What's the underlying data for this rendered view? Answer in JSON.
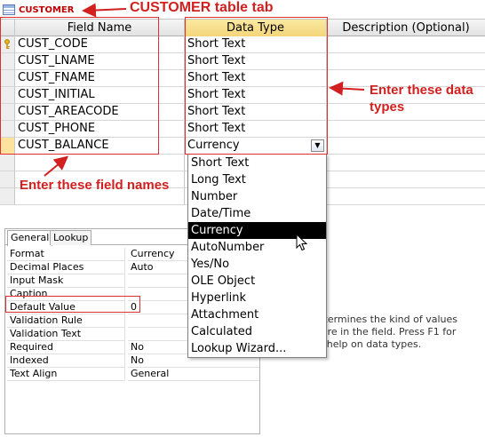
{
  "tab": {
    "label": "CUSTOMER"
  },
  "grid": {
    "headers": {
      "field_name": "Field Name",
      "data_type": "Data Type",
      "description": "Description (Optional)"
    },
    "rows": [
      {
        "field": "CUST_CODE",
        "type": "Short Text"
      },
      {
        "field": "CUST_LNAME",
        "type": "Short Text"
      },
      {
        "field": "CUST_FNAME",
        "type": "Short Text"
      },
      {
        "field": "CUST_INITIAL",
        "type": "Short Text"
      },
      {
        "field": "CUST_AREACODE",
        "type": "Short Text"
      },
      {
        "field": "CUST_PHONE",
        "type": "Short Text"
      },
      {
        "field": "CUST_BALANCE",
        "type": "Currency"
      }
    ]
  },
  "dropdown": {
    "options": [
      "Short Text",
      "Long Text",
      "Number",
      "Date/Time",
      "Currency",
      "AutoNumber",
      "Yes/No",
      "OLE Object",
      "Hyperlink",
      "Attachment",
      "Calculated",
      "Lookup Wizard..."
    ],
    "selected": "Currency"
  },
  "properties": {
    "tabs": {
      "general": "General",
      "lookup": "Lookup"
    },
    "rows": [
      {
        "label": "Format",
        "value": "Currency"
      },
      {
        "label": "Decimal Places",
        "value": "Auto"
      },
      {
        "label": "Input Mask",
        "value": ""
      },
      {
        "label": "Caption",
        "value": ""
      },
      {
        "label": "Default Value",
        "value": "0"
      },
      {
        "label": "Validation Rule",
        "value": ""
      },
      {
        "label": "Validation Text",
        "value": ""
      },
      {
        "label": "Required",
        "value": "No"
      },
      {
        "label": "Indexed",
        "value": "No"
      },
      {
        "label": "Text Align",
        "value": "General"
      }
    ]
  },
  "help": {
    "line1": "ype determines the kind of values",
    "line2": "can store in the field. Press F1 for",
    "line3": "help on data types."
  },
  "annotations": {
    "tab": "CUSTOMER table tab",
    "types": "Enter these data types",
    "fields": "Enter these field names"
  },
  "colors": {
    "annotation": "#d21f1f",
    "header_highlight": "#f4d67a",
    "selected_option": "#000000"
  }
}
